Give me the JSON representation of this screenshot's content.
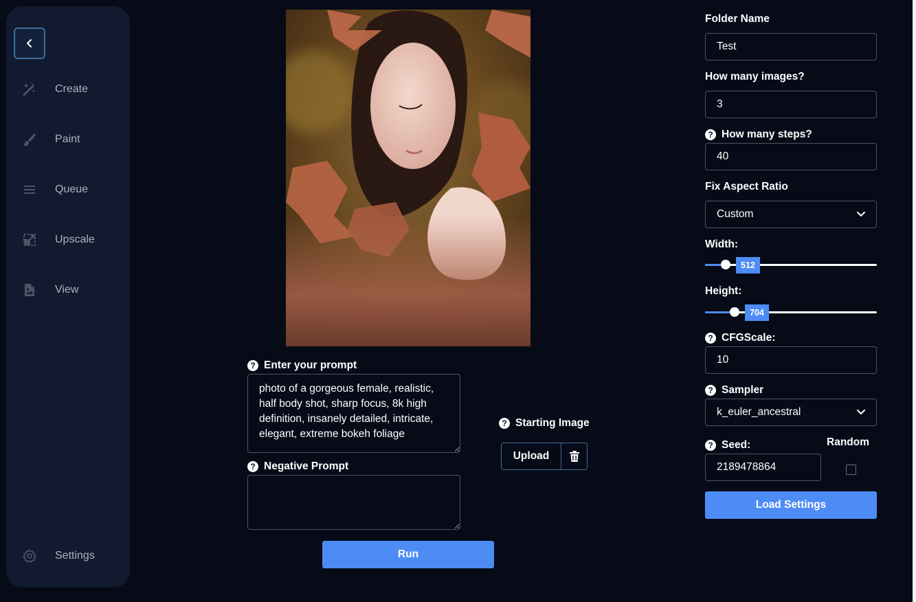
{
  "sidebar": {
    "items": [
      {
        "label": "Create",
        "icon": "magic-wand-icon"
      },
      {
        "label": "Paint",
        "icon": "brush-icon"
      },
      {
        "label": "Queue",
        "icon": "list-icon"
      },
      {
        "label": "Upscale",
        "icon": "upscale-icon"
      },
      {
        "label": "View",
        "icon": "image-file-icon"
      }
    ],
    "settings_label": "Settings"
  },
  "center": {
    "prompt_label": "Enter your prompt",
    "prompt_value": "photo of a gorgeous female, realistic, half body shot, sharp focus, 8k high definition, insanely detailed, intricate, elegant, extreme bokeh foliage",
    "negative_label": "Negative Prompt",
    "negative_value": "",
    "starting_image_label": "Starting Image",
    "upload_label": "Upload",
    "run_label": "Run"
  },
  "settings": {
    "folder_label": "Folder Name",
    "folder_value": "Test",
    "images_label": "How many images?",
    "images_value": "3",
    "steps_label": "How many steps?",
    "steps_value": "40",
    "aspect_label": "Fix Aspect Ratio",
    "aspect_value": "Custom",
    "width_label": "Width:",
    "width_value": "512",
    "width_fraction": 0.12,
    "height_label": "Height:",
    "height_value": "704",
    "height_fraction": 0.17,
    "cfg_label": "CFGScale:",
    "cfg_value": "10",
    "sampler_label": "Sampler",
    "sampler_value": "k_euler_ancestral",
    "seed_label": "Seed:",
    "seed_value": "2189478864",
    "random_label": "Random",
    "random_checked": false,
    "load_label": "Load Settings"
  },
  "colors": {
    "accent": "#4e8cf5",
    "background": "#070b17",
    "sidebar": "#111a2e"
  }
}
